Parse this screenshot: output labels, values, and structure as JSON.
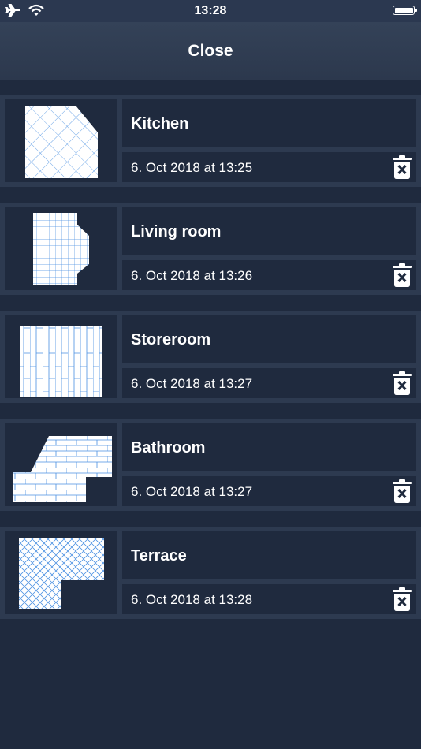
{
  "status_bar": {
    "time": "13:28"
  },
  "navbar": {
    "close_label": "Close"
  },
  "rooms": [
    {
      "name": "Kitchen",
      "date": "6. Oct 2018 at 13:25",
      "pattern": "diagonal-grid"
    },
    {
      "name": "Living room",
      "date": "6. Oct 2018 at 13:26",
      "pattern": "square-grid"
    },
    {
      "name": "Storeroom",
      "date": "6. Oct 2018 at 13:27",
      "pattern": "running-bond-vertical"
    },
    {
      "name": "Bathroom",
      "date": "6. Oct 2018 at 13:27",
      "pattern": "running-bond-horizontal"
    },
    {
      "name": "Terrace",
      "date": "6. Oct 2018 at 13:28",
      "pattern": "herringbone"
    }
  ],
  "colors": {
    "background": "#1f2a3e",
    "row": "#2d3a50",
    "tile_line": "#4a90e2"
  }
}
